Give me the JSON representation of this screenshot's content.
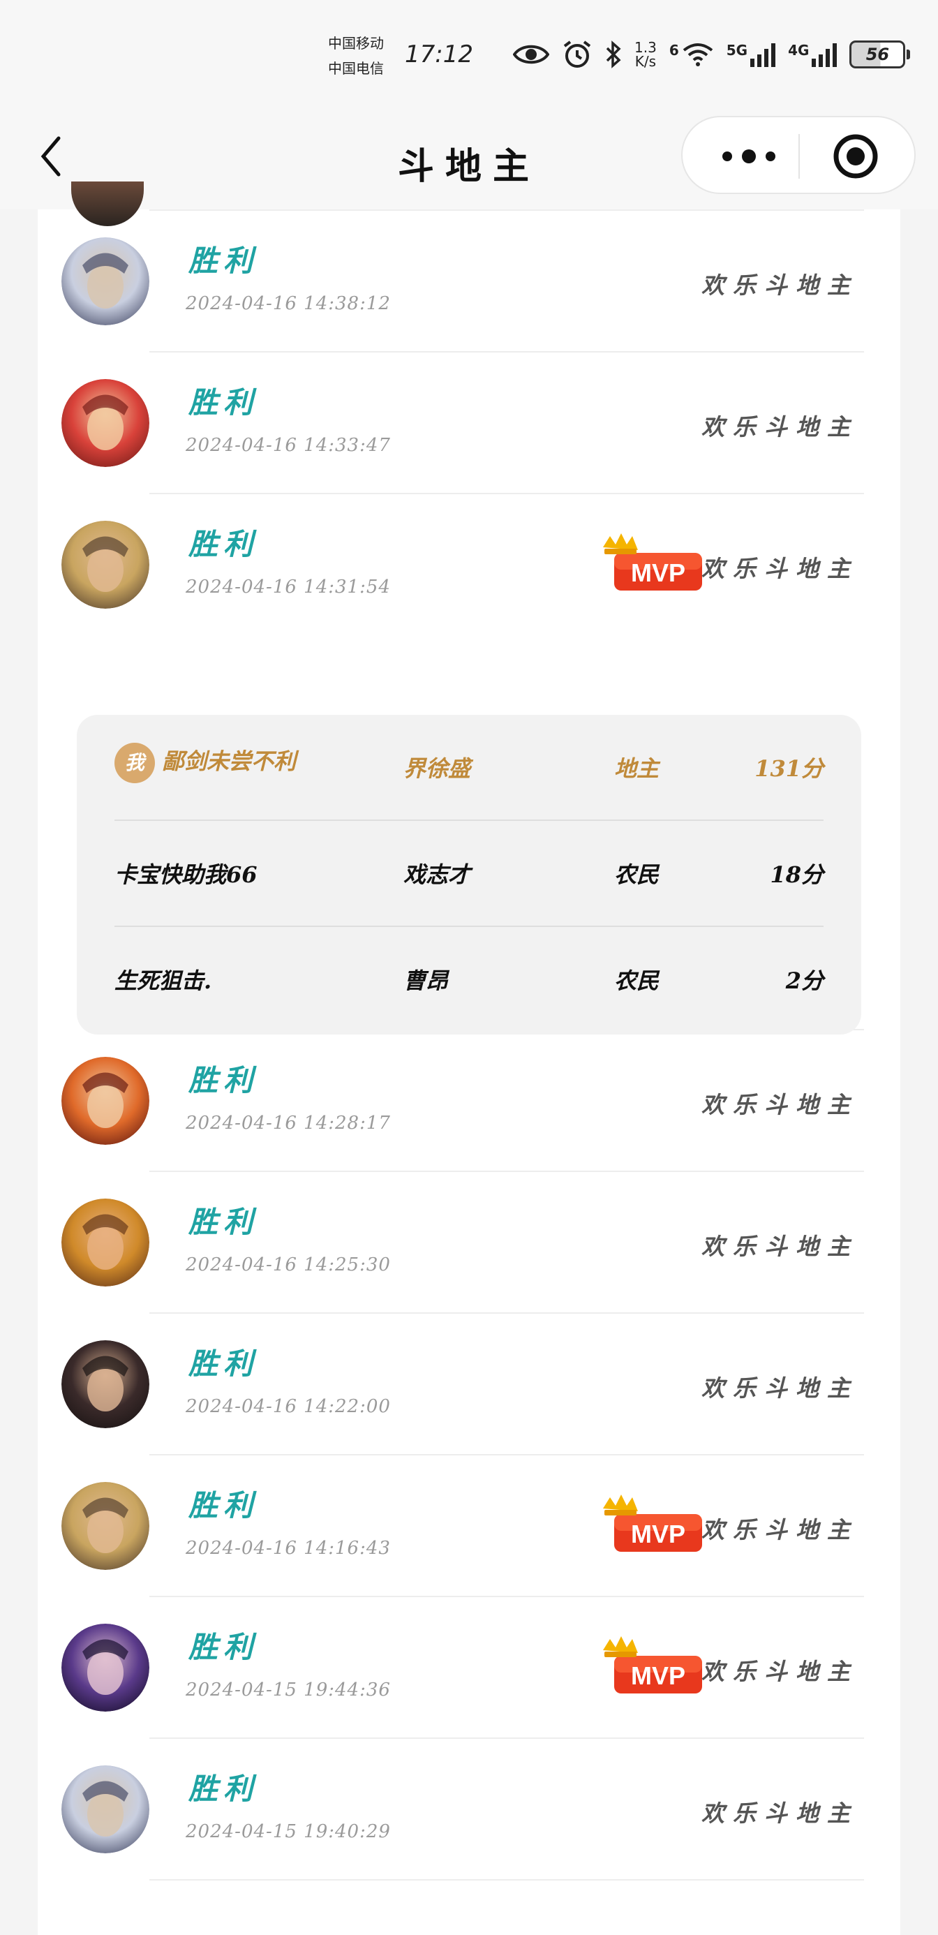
{
  "status_bar": {
    "carrier_1": "中国移动",
    "carrier_2": "中国电信",
    "time": "17:12",
    "speed_value": "1.3",
    "speed_unit": "K/s",
    "wifi_label": "6",
    "net1": "5G",
    "net2": "4G",
    "battery": "56",
    "icons": [
      "eye-icon",
      "alarm-icon",
      "bluetooth-icon",
      "wifi-icon",
      "signal-icon",
      "battery-icon"
    ]
  },
  "nav": {
    "title": "斗地主",
    "back_icon": "chevron-left-icon",
    "more_icon": "more-icon",
    "target_icon": "target-icon"
  },
  "games": [
    {
      "result": "胜利",
      "time": "2024-04-16 14:38:12",
      "mode": "欢乐斗地主",
      "mvp": false,
      "avatar": "hero-avatar-1"
    },
    {
      "result": "胜利",
      "time": "2024-04-16 14:33:47",
      "mode": "欢乐斗地主",
      "mvp": false,
      "avatar": "hero-avatar-2"
    },
    {
      "result": "胜利",
      "time": "2024-04-16 14:31:54",
      "mode": "欢乐斗地主",
      "mvp": true,
      "avatar": "hero-avatar-3"
    },
    {
      "result": "胜利",
      "time": "2024-04-16 14:28:17",
      "mode": "欢乐斗地主",
      "mvp": false,
      "avatar": "hero-avatar-4"
    },
    {
      "result": "胜利",
      "time": "2024-04-16 14:25:30",
      "mode": "欢乐斗地主",
      "mvp": false,
      "avatar": "hero-avatar-5"
    },
    {
      "result": "胜利",
      "time": "2024-04-16 14:22:00",
      "mode": "欢乐斗地主",
      "mvp": false,
      "avatar": "hero-avatar-6"
    },
    {
      "result": "胜利",
      "time": "2024-04-16 14:16:43",
      "mode": "欢乐斗地主",
      "mvp": true,
      "avatar": "hero-avatar-3"
    },
    {
      "result": "胜利",
      "time": "2024-04-15 19:44:36",
      "mode": "欢乐斗地主",
      "mvp": true,
      "avatar": "hero-avatar-7"
    },
    {
      "result": "胜利",
      "time": "2024-04-15 19:40:29",
      "mode": "欢乐斗地主",
      "mvp": false,
      "avatar": "hero-avatar-1"
    }
  ],
  "mvp_label": "MVP",
  "detail": {
    "me_badge": "我",
    "players": [
      {
        "name": "鄙剑未尝不利",
        "hero": "界徐盛",
        "role": "地主",
        "score": "131分",
        "is_me": true
      },
      {
        "name": "卡宝快助我66",
        "hero": "戏志才",
        "role": "农民",
        "score": "18分",
        "is_me": false
      },
      {
        "name": "生死狙击.",
        "hero": "曹昂",
        "role": "农民",
        "score": "2分",
        "is_me": false
      }
    ]
  },
  "colors": {
    "result": "#1fa3a3",
    "me": "#c08a3a",
    "mvp_red": "#e8381d",
    "crown": "#f5b400"
  }
}
